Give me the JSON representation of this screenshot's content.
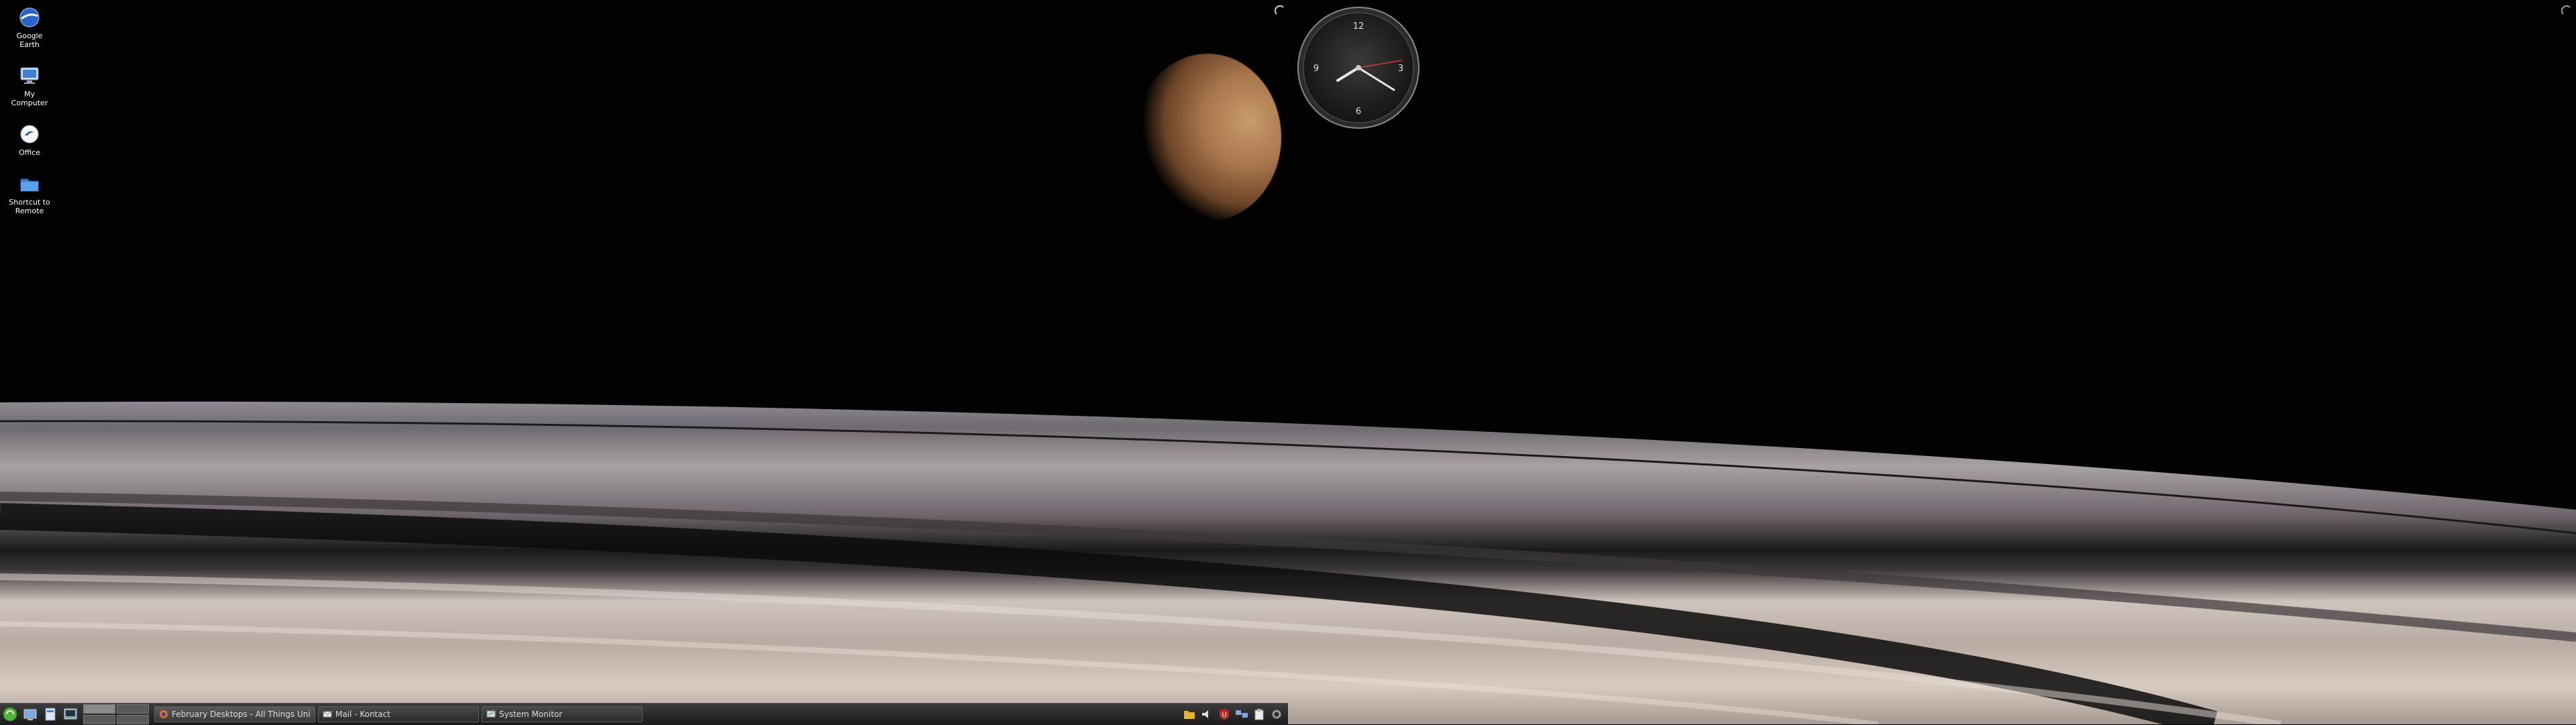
{
  "desktop": {
    "icons": [
      {
        "label": "Google\nEarth",
        "icon": "google-earth-icon"
      },
      {
        "label": "My\nComputer",
        "icon": "computer-icon"
      },
      {
        "label": "Office",
        "icon": "office-icon"
      },
      {
        "label": "Shortcut to\nRemote",
        "icon": "folder-icon"
      }
    ]
  },
  "clock": {
    "n12": "12",
    "n3": "3",
    "n6": "6",
    "n9": "9"
  },
  "taskbar": {
    "tasks": [
      {
        "label": "February Desktops - All Things Uni",
        "icon": "firefox-icon"
      },
      {
        "label": "Mail - Kontact",
        "icon": "mail-icon"
      },
      {
        "label": "System Monitor",
        "icon": "monitor-icon"
      }
    ],
    "tray": [
      "folder-icon",
      "volume-icon",
      "shield-icon",
      "network-icon",
      "clipboard-icon",
      "settings-icon"
    ]
  },
  "colors": {
    "taskbar": "#2a2a2a",
    "moon": "#b9875a"
  }
}
